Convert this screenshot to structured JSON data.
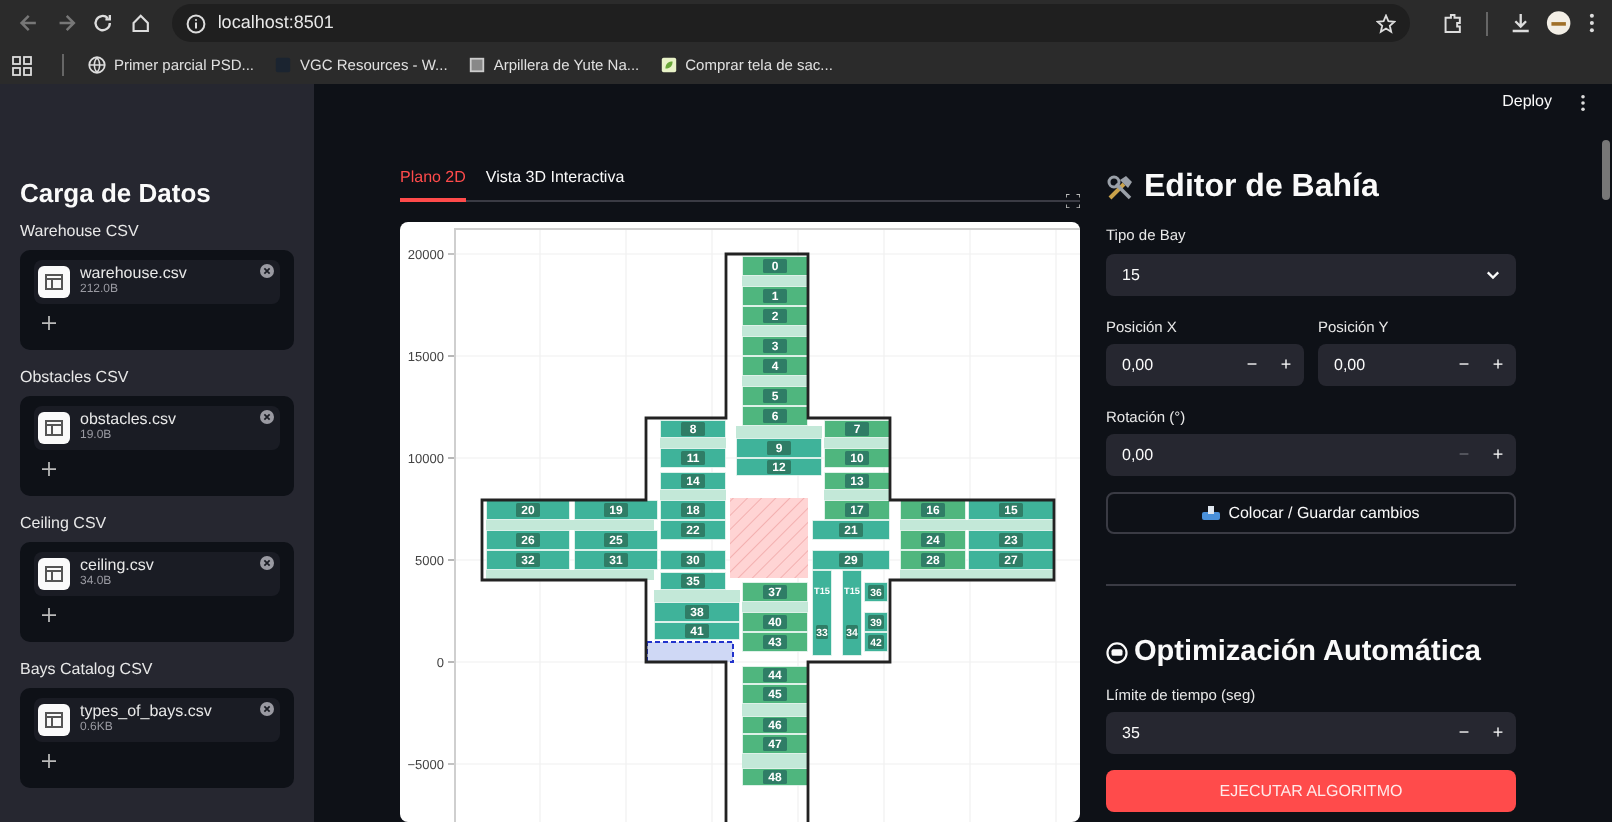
{
  "browser": {
    "url": "localhost:8501",
    "bookmarks": [
      "Primer parcial PSD...",
      "VGC Resources - W...",
      "Arpillera de Yute Na...",
      "Comprar tela de sac..."
    ]
  },
  "sidebar": {
    "title": "Carga de Datos",
    "uploaders": [
      {
        "label": "Warehouse CSV",
        "file": "warehouse.csv",
        "size": "212.0B"
      },
      {
        "label": "Obstacles CSV",
        "file": "obstacles.csv",
        "size": "19.0B"
      },
      {
        "label": "Ceiling CSV",
        "file": "ceiling.csv",
        "size": "34.0B"
      },
      {
        "label": "Bays Catalog CSV",
        "file": "types_of_bays.csv",
        "size": "0.6KB"
      }
    ]
  },
  "header": {
    "deploy": "Deploy"
  },
  "tabs": [
    {
      "label": "Plano 2D",
      "selected": true
    },
    {
      "label": "Vista 3D Interactiva",
      "selected": false
    }
  ],
  "plot": {
    "yticks": [
      "20000",
      "15000",
      "10000",
      "5000",
      "0",
      "−5000"
    ],
    "bays": [
      {
        "label": "0",
        "color": "#4fb67e"
      },
      {
        "label": "1",
        "color": "#4fb67e"
      },
      {
        "label": "2",
        "color": "#4fb67e"
      },
      {
        "label": "3",
        "color": "#4fb67e"
      },
      {
        "label": "4",
        "color": "#4fb67e"
      },
      {
        "label": "5",
        "color": "#4fb67e"
      },
      {
        "label": "6",
        "color": "#4fb67e"
      },
      {
        "label": "8",
        "color": "#3fb39a"
      },
      {
        "label": "7",
        "color": "#4fb67e"
      },
      {
        "label": "9",
        "color": "#3fb39a"
      },
      {
        "label": "11",
        "color": "#3fb39a"
      },
      {
        "label": "10",
        "color": "#4fb67e"
      },
      {
        "label": "12",
        "color": "#3fb39a"
      },
      {
        "label": "14",
        "color": "#3fb39a"
      },
      {
        "label": "13",
        "color": "#4fb67e"
      },
      {
        "label": "20",
        "color": "#3fb39a"
      },
      {
        "label": "19",
        "color": "#3fb39a"
      },
      {
        "label": "18",
        "color": "#3fb39a"
      },
      {
        "label": "17",
        "color": "#4fb67e"
      },
      {
        "label": "16",
        "color": "#4fb67e"
      },
      {
        "label": "15",
        "color": "#3fb39a"
      },
      {
        "label": "22",
        "color": "#3fb39a"
      },
      {
        "label": "21",
        "color": "#3fb39a"
      },
      {
        "label": "26",
        "color": "#3fb39a"
      },
      {
        "label": "25",
        "color": "#3fb39a"
      },
      {
        "label": "24",
        "color": "#4fb67e"
      },
      {
        "label": "23",
        "color": "#3fb39a"
      },
      {
        "label": "32",
        "color": "#3fb39a"
      },
      {
        "label": "31",
        "color": "#3fb39a"
      },
      {
        "label": "30",
        "color": "#3fb39a"
      },
      {
        "label": "29",
        "color": "#3fb39a"
      },
      {
        "label": "28",
        "color": "#4fb67e"
      },
      {
        "label": "27",
        "color": "#3fb39a"
      },
      {
        "label": "35",
        "color": "#3fb39a"
      },
      {
        "label": "37",
        "color": "#4fb67e"
      },
      {
        "label": "33",
        "color": "#3fb39a",
        "tag": "T15"
      },
      {
        "label": "34",
        "color": "#3fb39a",
        "tag": "T15"
      },
      {
        "label": "36",
        "color": "#3fb39a"
      },
      {
        "label": "38",
        "color": "#3fb39a"
      },
      {
        "label": "40",
        "color": "#4fb67e"
      },
      {
        "label": "39",
        "color": "#3fb39a"
      },
      {
        "label": "41",
        "color": "#3fb39a"
      },
      {
        "label": "43",
        "color": "#4fb67e"
      },
      {
        "label": "42",
        "color": "#3fb39a"
      },
      {
        "label": "44",
        "color": "#4fb67e"
      },
      {
        "label": "45",
        "color": "#4fb67e"
      },
      {
        "label": "46",
        "color": "#4fb67e"
      },
      {
        "label": "47",
        "color": "#4fb67e"
      },
      {
        "label": "48",
        "color": "#4fb67e"
      }
    ]
  },
  "editor": {
    "title": "Editor de Bahía",
    "bay_type": {
      "label": "Tipo de Bay",
      "value": "15"
    },
    "position_x": {
      "label": "Posición X",
      "value": "0,00",
      "decrement": "−",
      "increment": "+",
      "decrement_disabled": false
    },
    "position_y": {
      "label": "Posición Y",
      "value": "0,00",
      "decrement": "−",
      "increment": "+",
      "decrement_disabled": false
    },
    "rotation": {
      "label": "Rotación (°)",
      "value": "0,00",
      "decrement": "−",
      "increment": "+",
      "decrement_disabled": true
    },
    "save_button": "Colocar / Guardar cambios"
  },
  "optimization": {
    "title": "Optimización Automática",
    "time_limit": {
      "label": "Límite de tiempo (seg)",
      "value": "35",
      "decrement": "−",
      "increment": "+",
      "decrement_disabled": false
    },
    "run_button": "EJECUTAR ALGORITMO"
  }
}
